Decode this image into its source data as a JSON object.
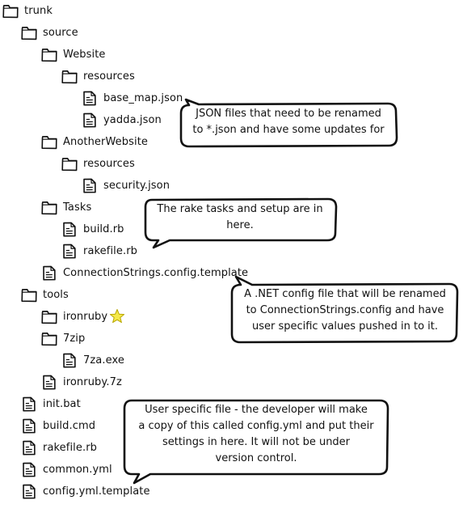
{
  "tree": {
    "trunk": "trunk",
    "source": "source",
    "website": "Website",
    "website_resources": "resources",
    "base_map_json": "base_map.json",
    "yadda_json": "yadda.json",
    "another_website": "AnotherWebsite",
    "another_resources": "resources",
    "security_json": "security.json",
    "tasks": "Tasks",
    "build_rb": "build.rb",
    "tasks_rakefile_rb": "rakefile.rb",
    "connection_strings_template": "ConnectionStrings.config.template",
    "tools": "tools",
    "ironruby": "ironruby",
    "sevenzip": "7zip",
    "sevenza_exe": "7za.exe",
    "ironruby_7z": "ironruby.7z",
    "init_bat": "init.bat",
    "build_cmd": "build.cmd",
    "root_rakefile_rb": "rakefile.rb",
    "common_yml": "common.yml",
    "config_yml_template": "config.yml.template"
  },
  "callouts": {
    "json": "JSON files that need to be renamed\nto *.json and have some updates for",
    "rake": "The rake tasks and setup are in\nhere.",
    "config": "A .NET config file that will be renamed\nto ConnectionStrings.config and have\nuser specific values pushed in to it.",
    "user": "User specific file - the developer will make\na copy of this called config.yml and put their\nsettings in here. It will not be under\nversion control."
  },
  "colors": {
    "ink": "#111111",
    "star_fill": "#f5e94a",
    "star_stroke": "#b8a600"
  }
}
